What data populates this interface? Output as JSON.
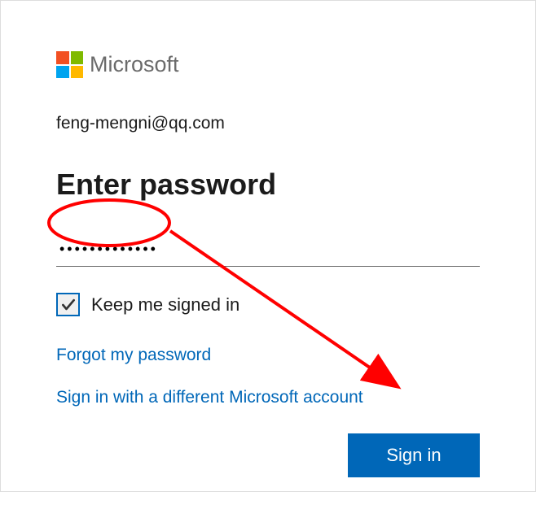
{
  "brand": {
    "name": "Microsoft"
  },
  "account": {
    "email": "feng-mengni@qq.com"
  },
  "form": {
    "title": "Enter password",
    "password_value": "•••••••••••••",
    "keep_signed_in_label": "Keep me signed in",
    "keep_signed_in_checked": true,
    "forgot_link": "Forgot my password",
    "different_account_link": "Sign in with a different Microsoft account",
    "signin_button": "Sign in"
  }
}
